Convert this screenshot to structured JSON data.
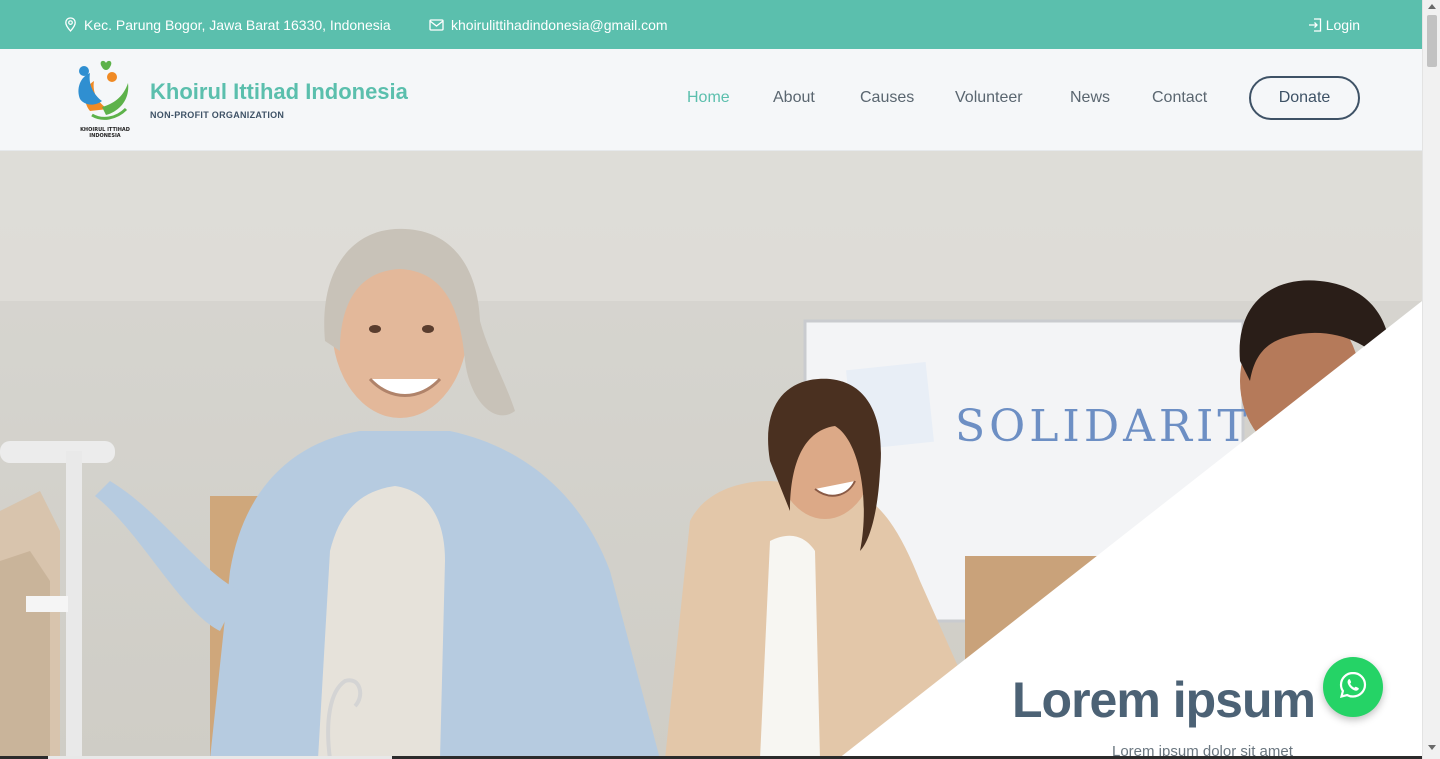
{
  "topbar": {
    "address": "Kec. Parung Bogor, Jawa Barat 16330, Indonesia",
    "email": "khoirulittihadindonesia@gmail.com",
    "login_label": "Login"
  },
  "brand": {
    "name": "Khoirul Ittihad Indonesia",
    "tagline": "NON-PROFIT ORGANIZATION",
    "logo_text": "KHOIRUL ITTIHAD INDONESIA"
  },
  "nav": {
    "items": [
      {
        "label": "Home",
        "active": true
      },
      {
        "label": "About",
        "active": false
      },
      {
        "label": "Causes",
        "active": false
      },
      {
        "label": "Volunteer",
        "active": false
      },
      {
        "label": "News",
        "active": false
      },
      {
        "label": "Contact",
        "active": false
      }
    ],
    "donate_label": "Donate"
  },
  "hero": {
    "title": "Lorem ipsum",
    "subtitle": "Lorem ipsum dolor sit amet",
    "whiteboard_text": "SOLIDARITY"
  },
  "colors": {
    "accent": "#5bbfad",
    "dark": "#3e5266",
    "whatsapp": "#25d366"
  },
  "icons": {
    "address": "map-pin-icon",
    "email": "envelope-icon",
    "login": "login-icon",
    "whatsapp": "whatsapp-icon"
  }
}
